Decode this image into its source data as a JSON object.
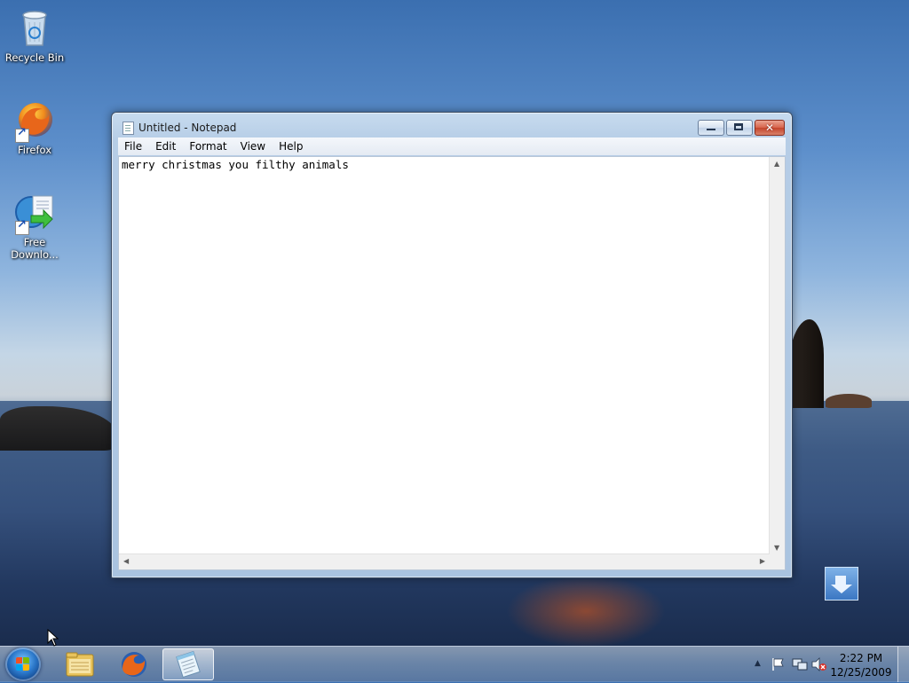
{
  "desktop": {
    "icons": [
      {
        "label": "Recycle Bin",
        "icon": "recycle-bin-icon"
      },
      {
        "label": "Firefox",
        "icon": "firefox-icon"
      },
      {
        "label": "Free Downlo...",
        "icon": "free-download-manager-icon"
      }
    ]
  },
  "window": {
    "title": "Untitled - Notepad",
    "menu": [
      "File",
      "Edit",
      "Format",
      "View",
      "Help"
    ],
    "content": "merry christmas you filthy animals",
    "buttons": {
      "minimize": "minimize",
      "maximize": "maximize",
      "close": "close"
    }
  },
  "taskbar": {
    "items": [
      {
        "name": "windows-explorer",
        "icon": "folder-icon"
      },
      {
        "name": "firefox",
        "icon": "firefox-icon"
      },
      {
        "name": "notepad",
        "icon": "notepad-icon",
        "active": true
      }
    ],
    "tray": {
      "time": "2:22 PM",
      "date": "12/25/2009",
      "icons": [
        "show-hidden-icons-arrow",
        "action-center-flag-icon",
        "network-icon",
        "volume-muted-icon"
      ]
    }
  },
  "colors": {
    "accent": "#3b77c3",
    "close_button": "#c4442b"
  }
}
